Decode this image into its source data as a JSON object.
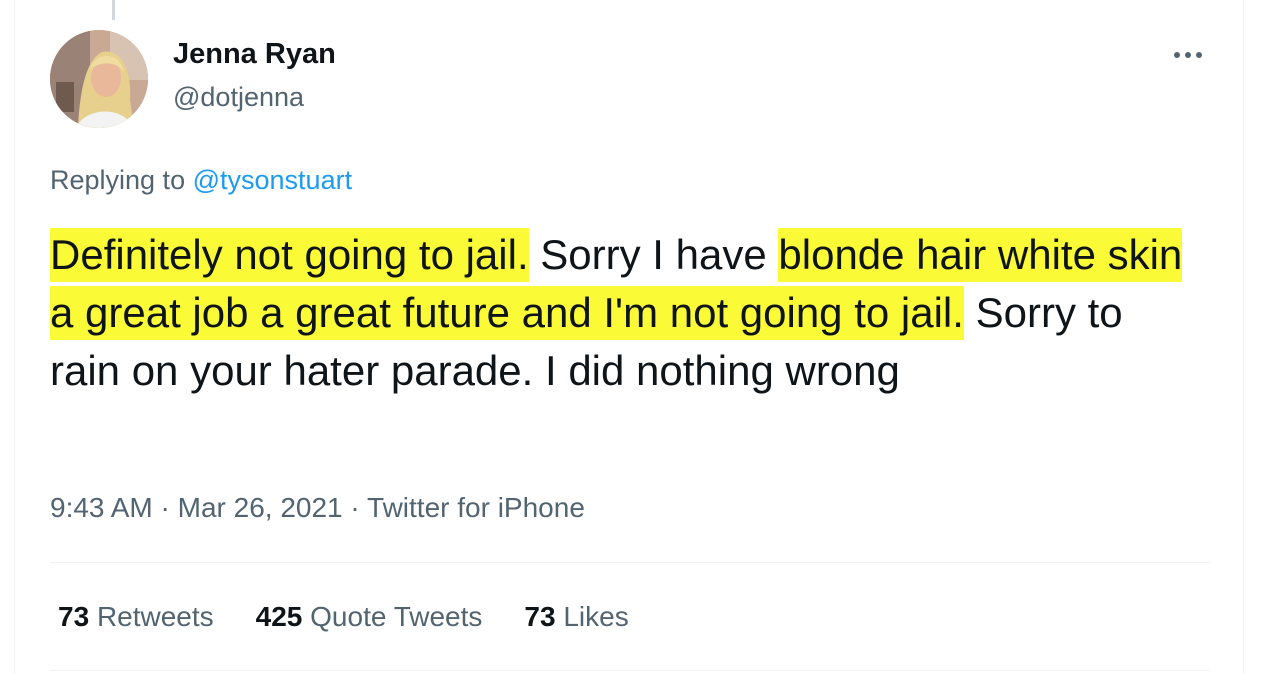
{
  "author": {
    "display_name": "Jenna Ryan",
    "handle": "@dotjenna"
  },
  "reply": {
    "prefix": "Replying to",
    "mention": "@tysonstuart"
  },
  "tweet": {
    "segments": [
      {
        "text": "Definitely not going to jail.",
        "highlighted": true
      },
      {
        "text": " Sorry I have ",
        "highlighted": false
      },
      {
        "text": "blonde hair white skin a great job a great future and I'm not going to jail.",
        "highlighted": true
      },
      {
        "text": " Sorry to rain on your hater parade. I did nothing wrong",
        "highlighted": false
      }
    ],
    "highlight_color": "#fbfa36"
  },
  "meta": {
    "time": "9:43 AM",
    "separator": "·",
    "date": "Mar 26, 2021",
    "source": "Twitter for iPhone"
  },
  "stats": {
    "retweets_count": "73",
    "retweets_label": "Retweets",
    "quotes_count": "425",
    "quotes_label": "Quote Tweets",
    "likes_count": "73",
    "likes_label": "Likes"
  },
  "colors": {
    "text_primary": "#0f1419",
    "text_secondary": "#536471",
    "link": "#1d9bf0",
    "divider": "#eff3f4"
  },
  "icons": {
    "more": "more-horizontal-icon"
  }
}
